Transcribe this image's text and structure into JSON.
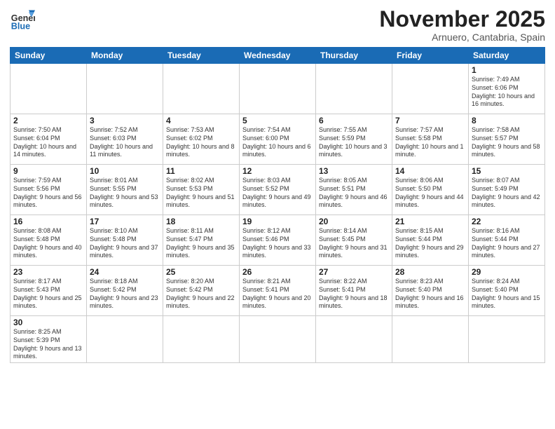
{
  "logo": {
    "general": "General",
    "blue": "Blue"
  },
  "header": {
    "month": "November 2025",
    "location": "Arnuero, Cantabria, Spain"
  },
  "weekdays": [
    "Sunday",
    "Monday",
    "Tuesday",
    "Wednesday",
    "Thursday",
    "Friday",
    "Saturday"
  ],
  "weeks": [
    [
      {
        "day": "",
        "info": ""
      },
      {
        "day": "",
        "info": ""
      },
      {
        "day": "",
        "info": ""
      },
      {
        "day": "",
        "info": ""
      },
      {
        "day": "",
        "info": ""
      },
      {
        "day": "",
        "info": ""
      },
      {
        "day": "1",
        "info": "Sunrise: 7:49 AM\nSunset: 6:06 PM\nDaylight: 10 hours and 16 minutes."
      }
    ],
    [
      {
        "day": "2",
        "info": "Sunrise: 7:50 AM\nSunset: 6:04 PM\nDaylight: 10 hours and 14 minutes."
      },
      {
        "day": "3",
        "info": "Sunrise: 7:52 AM\nSunset: 6:03 PM\nDaylight: 10 hours and 11 minutes."
      },
      {
        "day": "4",
        "info": "Sunrise: 7:53 AM\nSunset: 6:02 PM\nDaylight: 10 hours and 8 minutes."
      },
      {
        "day": "5",
        "info": "Sunrise: 7:54 AM\nSunset: 6:00 PM\nDaylight: 10 hours and 6 minutes."
      },
      {
        "day": "6",
        "info": "Sunrise: 7:55 AM\nSunset: 5:59 PM\nDaylight: 10 hours and 3 minutes."
      },
      {
        "day": "7",
        "info": "Sunrise: 7:57 AM\nSunset: 5:58 PM\nDaylight: 10 hours and 1 minute."
      },
      {
        "day": "8",
        "info": "Sunrise: 7:58 AM\nSunset: 5:57 PM\nDaylight: 9 hours and 58 minutes."
      }
    ],
    [
      {
        "day": "9",
        "info": "Sunrise: 7:59 AM\nSunset: 5:56 PM\nDaylight: 9 hours and 56 minutes."
      },
      {
        "day": "10",
        "info": "Sunrise: 8:01 AM\nSunset: 5:55 PM\nDaylight: 9 hours and 53 minutes."
      },
      {
        "day": "11",
        "info": "Sunrise: 8:02 AM\nSunset: 5:53 PM\nDaylight: 9 hours and 51 minutes."
      },
      {
        "day": "12",
        "info": "Sunrise: 8:03 AM\nSunset: 5:52 PM\nDaylight: 9 hours and 49 minutes."
      },
      {
        "day": "13",
        "info": "Sunrise: 8:05 AM\nSunset: 5:51 PM\nDaylight: 9 hours and 46 minutes."
      },
      {
        "day": "14",
        "info": "Sunrise: 8:06 AM\nSunset: 5:50 PM\nDaylight: 9 hours and 44 minutes."
      },
      {
        "day": "15",
        "info": "Sunrise: 8:07 AM\nSunset: 5:49 PM\nDaylight: 9 hours and 42 minutes."
      }
    ],
    [
      {
        "day": "16",
        "info": "Sunrise: 8:08 AM\nSunset: 5:48 PM\nDaylight: 9 hours and 40 minutes."
      },
      {
        "day": "17",
        "info": "Sunrise: 8:10 AM\nSunset: 5:48 PM\nDaylight: 9 hours and 37 minutes."
      },
      {
        "day": "18",
        "info": "Sunrise: 8:11 AM\nSunset: 5:47 PM\nDaylight: 9 hours and 35 minutes."
      },
      {
        "day": "19",
        "info": "Sunrise: 8:12 AM\nSunset: 5:46 PM\nDaylight: 9 hours and 33 minutes."
      },
      {
        "day": "20",
        "info": "Sunrise: 8:14 AM\nSunset: 5:45 PM\nDaylight: 9 hours and 31 minutes."
      },
      {
        "day": "21",
        "info": "Sunrise: 8:15 AM\nSunset: 5:44 PM\nDaylight: 9 hours and 29 minutes."
      },
      {
        "day": "22",
        "info": "Sunrise: 8:16 AM\nSunset: 5:44 PM\nDaylight: 9 hours and 27 minutes."
      }
    ],
    [
      {
        "day": "23",
        "info": "Sunrise: 8:17 AM\nSunset: 5:43 PM\nDaylight: 9 hours and 25 minutes."
      },
      {
        "day": "24",
        "info": "Sunrise: 8:18 AM\nSunset: 5:42 PM\nDaylight: 9 hours and 23 minutes."
      },
      {
        "day": "25",
        "info": "Sunrise: 8:20 AM\nSunset: 5:42 PM\nDaylight: 9 hours and 22 minutes."
      },
      {
        "day": "26",
        "info": "Sunrise: 8:21 AM\nSunset: 5:41 PM\nDaylight: 9 hours and 20 minutes."
      },
      {
        "day": "27",
        "info": "Sunrise: 8:22 AM\nSunset: 5:41 PM\nDaylight: 9 hours and 18 minutes."
      },
      {
        "day": "28",
        "info": "Sunrise: 8:23 AM\nSunset: 5:40 PM\nDaylight: 9 hours and 16 minutes."
      },
      {
        "day": "29",
        "info": "Sunrise: 8:24 AM\nSunset: 5:40 PM\nDaylight: 9 hours and 15 minutes."
      }
    ],
    [
      {
        "day": "30",
        "info": "Sunrise: 8:25 AM\nSunset: 5:39 PM\nDaylight: 9 hours and 13 minutes."
      },
      {
        "day": "",
        "info": ""
      },
      {
        "day": "",
        "info": ""
      },
      {
        "day": "",
        "info": ""
      },
      {
        "day": "",
        "info": ""
      },
      {
        "day": "",
        "info": ""
      },
      {
        "day": "",
        "info": ""
      }
    ]
  ]
}
